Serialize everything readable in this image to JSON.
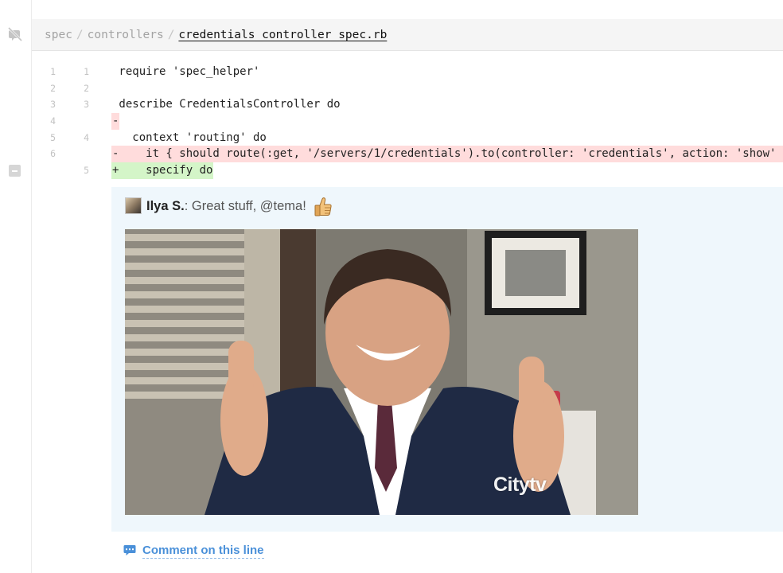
{
  "breadcrumb": {
    "parts": [
      "spec",
      "controllers"
    ],
    "file": "credentials_controller_spec.rb"
  },
  "diff": {
    "lines": [
      {
        "old": "1",
        "new": "1",
        "type": "context",
        "code": " require 'spec_helper'"
      },
      {
        "old": "2",
        "new": "2",
        "type": "context",
        "code": ""
      },
      {
        "old": "3",
        "new": "3",
        "type": "context",
        "code": " describe CredentialsController do"
      },
      {
        "old": "4",
        "new": "",
        "type": "del",
        "code": "-"
      },
      {
        "old": "5",
        "new": "4",
        "type": "context",
        "code": "   context 'routing' do"
      },
      {
        "old": "6",
        "new": "",
        "type": "del",
        "code": "-    it { should route(:get, '/servers/1/credentials').to(controller: 'credentials', action: 'show'"
      },
      {
        "old": "",
        "new": "5",
        "type": "add",
        "code": "+    specify do"
      }
    ]
  },
  "comment": {
    "author": "Ilya S.",
    "separator": ":",
    "text": " Great stuff, @tema!",
    "gif_watermark": "Citytv"
  },
  "actions": {
    "comment_on_line": "Comment on this line"
  },
  "icons": {
    "mute": "mute-notifications-icon",
    "collapse": "collapse-icon",
    "thumbs_up": "thumbs-up-icon",
    "comment": "comment-bubble-icon"
  },
  "colors": {
    "deleted_bg": "#ffdcdc",
    "added_bg": "#d4f5c8",
    "comment_bg": "#eff7fc",
    "link": "#4a90d9"
  }
}
